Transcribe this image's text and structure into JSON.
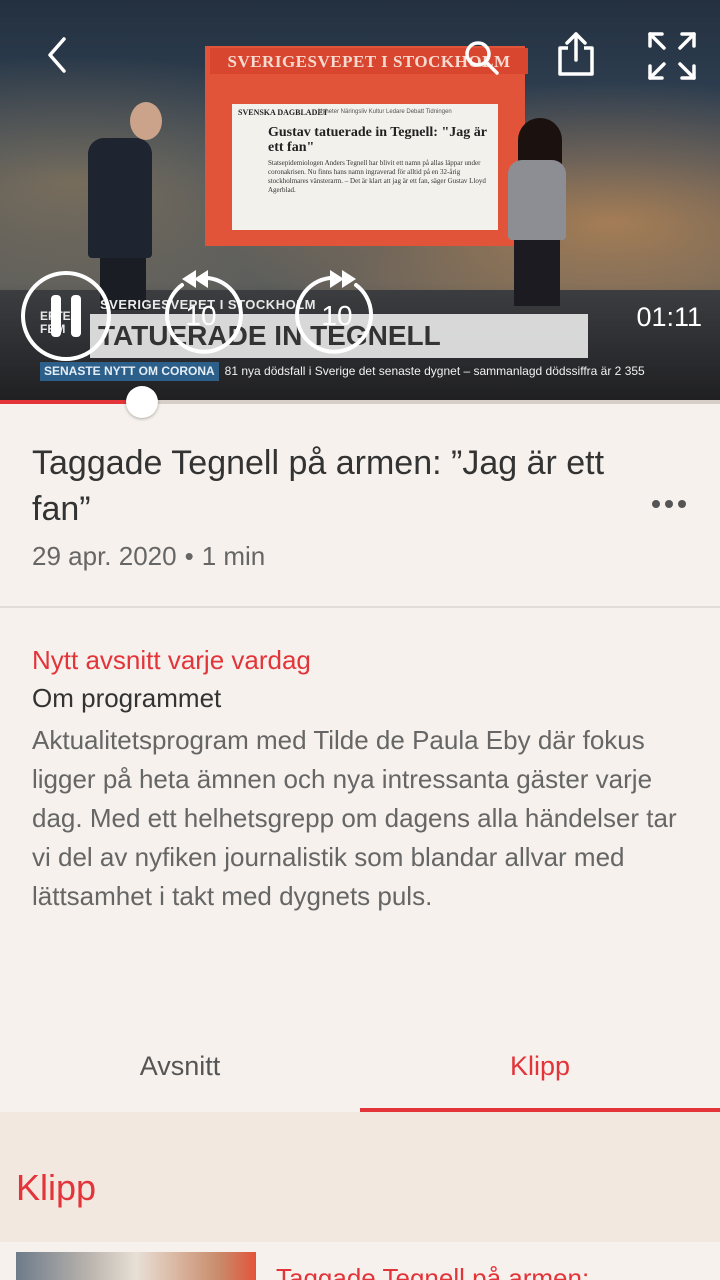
{
  "player": {
    "studio_screen_header": "SVERIGESVEPET I STOCKHOLM",
    "newspaper": {
      "brand": "SVENSKA DAGBLADET",
      "nav": "Nyheter   Näringsliv   Kultur   Ledare   Debatt   Tidningen",
      "headline": "Gustav tatuerade in Tegnell: \"Jag är ett fan\"",
      "body": "Statsepidemiologen Anders Tegnell har blivit ett namn på allas läppar under coronakrisen. Nu finns hans namn ingraverad för alltid på en 32-årig stockholmares vänsterarm. – Det är klart att jag är ett fan, säger Gustav Lloyd Agerblad."
    },
    "lower_third": {
      "top_line": "SVERIGESVEPET I STOCKHOLM",
      "main_line": "TATUERADE IN TEGNELL",
      "logo": "EFTER FEM"
    },
    "ticker": {
      "label": "SENASTE NYTT OM CORONA",
      "text": "81 nya dödsfall i Sverige det senaste dygnet – sammanlagd dödssiffra är 2 355"
    },
    "rewind_seconds": "10",
    "forward_seconds": "10",
    "elapsed_time": "01:11",
    "progress_fraction": 0.197,
    "accent_color": "#e3343a"
  },
  "icons": {
    "back": "chevron-left-icon",
    "search": "search-icon",
    "share": "share-icon",
    "fullscreen": "fullscreen-icon",
    "pause": "pause-icon",
    "rewind": "rewind-10-icon",
    "forward": "forward-10-icon",
    "more": "more-options-icon"
  },
  "episode": {
    "title": "Taggade Tegnell på armen: ”Jag är ett fan”",
    "date": "29 apr. 2020",
    "separator": "•",
    "duration": "1 min"
  },
  "program": {
    "schedule": "Nytt avsnitt varje vardag",
    "about_heading": "Om programmet",
    "about_text": "Aktualitetsprogram med Tilde de Paula Eby där fokus ligger på heta ämnen och nya intressanta gäster varje dag. Med ett helhetsgrepp om dagens alla händelser tar vi del av nyfiken journalistik som blandar allvar med lättsamhet i takt med dygnets puls."
  },
  "tabs": [
    {
      "label": "Avsnitt",
      "active": false
    },
    {
      "label": "Klipp",
      "active": true
    }
  ],
  "clips": {
    "heading": "Klipp",
    "items": [
      {
        "title": "Taggade Tegnell på armen:"
      }
    ]
  }
}
